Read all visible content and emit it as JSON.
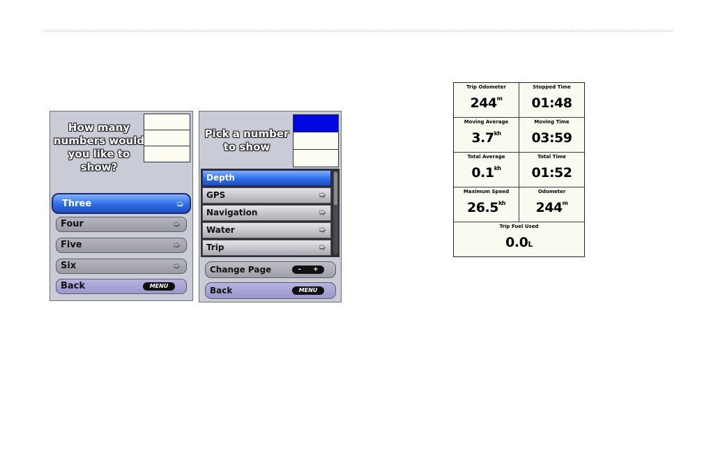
{
  "screen1": {
    "prompt": "How many numbers would you like to show?",
    "options": [
      {
        "label": "Three",
        "selected": true
      },
      {
        "label": "Four"
      },
      {
        "label": "Five"
      },
      {
        "label": "Six"
      }
    ],
    "back_label": "Back",
    "menu_label": "MENU"
  },
  "screen2": {
    "prompt": "Pick a number to show",
    "list": [
      "Depth",
      "GPS",
      "Navigation",
      "Water",
      "Trip"
    ],
    "change_page_label": "Change Page",
    "minus": "–",
    "plus": "+",
    "back_label": "Back",
    "menu_label": "MENU"
  },
  "trip_data": {
    "cells": [
      {
        "label": "Trip Odometer",
        "value": "244",
        "unit": "m"
      },
      {
        "label": "Stopped Time",
        "value": "01:48",
        "unit": ""
      },
      {
        "label": "Moving Average",
        "value": "3.7",
        "unit": "kh"
      },
      {
        "label": "Moving Time",
        "value": "03:59",
        "unit": ""
      },
      {
        "label": "Total Average",
        "value": "0.1",
        "unit": "kh"
      },
      {
        "label": "Total Time",
        "value": "01:52",
        "unit": ""
      },
      {
        "label": "Maximum Speed",
        "value": "26.5",
        "unit": "kh"
      },
      {
        "label": "Odometer",
        "value": "244",
        "unit": "m"
      },
      {
        "label": "Trip Fuel Used",
        "value": "0.0",
        "unit": "L"
      }
    ]
  }
}
